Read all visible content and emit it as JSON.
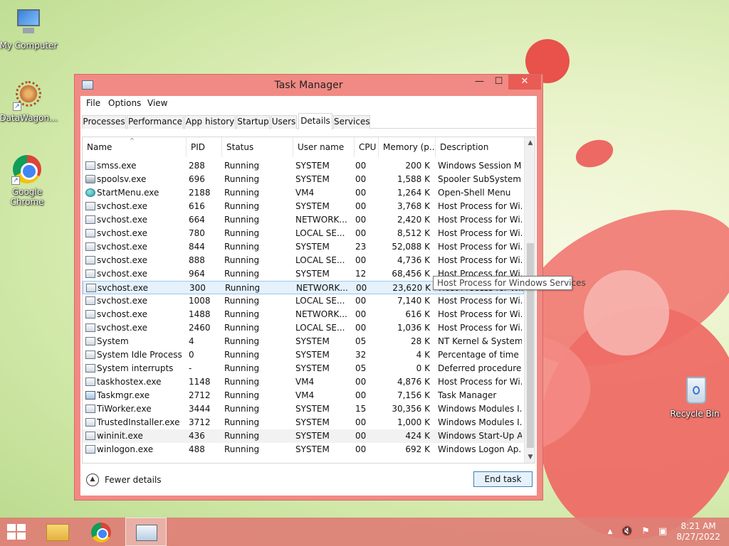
{
  "desktop": {
    "icons": [
      {
        "label": "My Computer"
      },
      {
        "label": "DataWagon..."
      },
      {
        "label": "Google Chrome"
      },
      {
        "label": "Recycle Bin"
      }
    ]
  },
  "window": {
    "title": "Task Manager",
    "controls": {
      "min": "—",
      "max": "☐",
      "close": "✕"
    }
  },
  "menu": {
    "items": [
      "File",
      "Options",
      "View"
    ]
  },
  "tabs": [
    "Processes",
    "Performance",
    "App history",
    "Startup",
    "Users",
    "Details",
    "Services"
  ],
  "active_tab": "Details",
  "table": {
    "columns": [
      "Name",
      "PID",
      "Status",
      "User name",
      "CPU",
      "Memory (p...",
      "Description"
    ],
    "rows": [
      [
        "smss.exe",
        "288",
        "Running",
        "SYSTEM",
        "00",
        "200 K",
        "Windows Session M..."
      ],
      [
        "spoolsv.exe",
        "696",
        "Running",
        "SYSTEM",
        "00",
        "1,588 K",
        "Spooler SubSystem ..."
      ],
      [
        "StartMenu.exe",
        "2188",
        "Running",
        "VM4",
        "00",
        "1,264 K",
        "Open-Shell Menu"
      ],
      [
        "svchost.exe",
        "616",
        "Running",
        "SYSTEM",
        "00",
        "3,768 K",
        "Host Process for Wi..."
      ],
      [
        "svchost.exe",
        "664",
        "Running",
        "NETWORK...",
        "00",
        "2,420 K",
        "Host Process for Wi..."
      ],
      [
        "svchost.exe",
        "780",
        "Running",
        "LOCAL SE...",
        "00",
        "8,512 K",
        "Host Process for Wi..."
      ],
      [
        "svchost.exe",
        "844",
        "Running",
        "SYSTEM",
        "23",
        "52,088 K",
        "Host Process for Wi..."
      ],
      [
        "svchost.exe",
        "888",
        "Running",
        "LOCAL SE...",
        "00",
        "4,736 K",
        "Host Process for Wi..."
      ],
      [
        "svchost.exe",
        "964",
        "Running",
        "SYSTEM",
        "12",
        "68,456 K",
        "Host Process for Wi..."
      ],
      [
        "svchost.exe",
        "300",
        "Running",
        "NETWORK...",
        "00",
        "23,620 K",
        "Host Process for Wi..."
      ],
      [
        "svchost.exe",
        "1008",
        "Running",
        "LOCAL SE...",
        "00",
        "7,140 K",
        "Host Process for Wi..."
      ],
      [
        "svchost.exe",
        "1488",
        "Running",
        "NETWORK...",
        "00",
        "616 K",
        "Host Process for Wi..."
      ],
      [
        "svchost.exe",
        "2460",
        "Running",
        "LOCAL SE...",
        "00",
        "1,036 K",
        "Host Process for Wi..."
      ],
      [
        "System",
        "4",
        "Running",
        "SYSTEM",
        "05",
        "28 K",
        "NT Kernel & System"
      ],
      [
        "System Idle Process",
        "0",
        "Running",
        "SYSTEM",
        "32",
        "4 K",
        "Percentage of time t..."
      ],
      [
        "System interrupts",
        "-",
        "Running",
        "SYSTEM",
        "05",
        "0 K",
        "Deferred procedure ..."
      ],
      [
        "taskhostex.exe",
        "1148",
        "Running",
        "VM4",
        "00",
        "4,876 K",
        "Host Process for Wi..."
      ],
      [
        "Taskmgr.exe",
        "2712",
        "Running",
        "VM4",
        "00",
        "7,156 K",
        "Task Manager"
      ],
      [
        "TiWorker.exe",
        "3444",
        "Running",
        "SYSTEM",
        "15",
        "30,356 K",
        "Windows Modules I..."
      ],
      [
        "TrustedInstaller.exe",
        "3712",
        "Running",
        "SYSTEM",
        "00",
        "1,000 K",
        "Windows Modules I..."
      ],
      [
        "wininit.exe",
        "436",
        "Running",
        "SYSTEM",
        "00",
        "424 K",
        "Windows Start-Up A..."
      ],
      [
        "winlogon.exe",
        "488",
        "Running",
        "SYSTEM",
        "00",
        "692 K",
        "Windows Logon Ap..."
      ]
    ],
    "row_icons": [
      "default-process-icon",
      "printer-process-icon",
      "startmenu-process-icon",
      "default-process-icon",
      "default-process-icon",
      "default-process-icon",
      "default-process-icon",
      "default-process-icon",
      "default-process-icon",
      "default-process-icon",
      "default-process-icon",
      "default-process-icon",
      "default-process-icon",
      "default-process-icon",
      "default-process-icon",
      "default-process-icon",
      "default-process-icon",
      "taskmgr-process-icon",
      "default-process-icon",
      "default-process-icon",
      "default-process-icon",
      "default-process-icon"
    ],
    "selected_index": 9,
    "hover_index": 20
  },
  "tooltip": "Host Process for Windows Services",
  "footer": {
    "fewer_details": "Fewer details",
    "end_task": "End task"
  },
  "taskbar": {
    "clock_time": "8:21 AM",
    "clock_date": "8/27/2022",
    "tray": {
      "up": "▲",
      "volume": "🔇",
      "flag": "⚑",
      "network": "▣"
    }
  },
  "colors": {
    "accent": "#f18a84",
    "selection": "#e5f1fb",
    "taskbar": "#de7e76"
  }
}
